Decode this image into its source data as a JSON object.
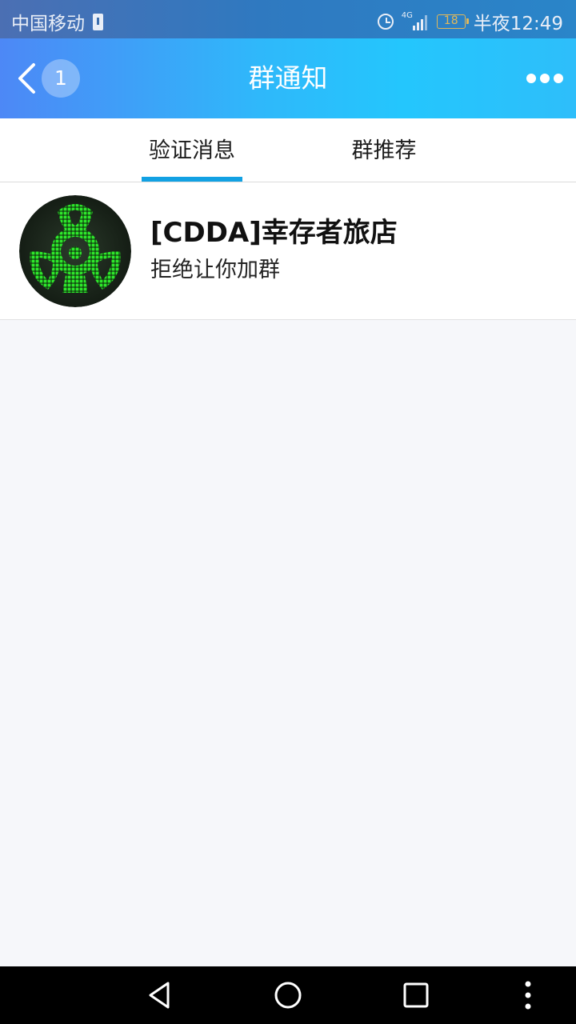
{
  "status_bar": {
    "carrier": "中国移动",
    "network_label": "4G",
    "battery_level": "18",
    "time": "半夜12:49"
  },
  "header": {
    "unread_count": "1",
    "title": "群通知"
  },
  "tabs": [
    {
      "label": "验证消息",
      "active": true
    },
    {
      "label": "群推荐",
      "active": false
    }
  ],
  "notices": [
    {
      "group_name": "[CDDA]幸存者旅店",
      "message": "拒绝让你加群",
      "avatar": "biohazard-icon"
    }
  ],
  "colors": {
    "header_gradient_start": "#4d88f6",
    "header_gradient_end": "#24c6fd",
    "tab_accent": "#12a1e3",
    "page_background": "#f6f7fa",
    "avatar_green": "#2ee82b"
  },
  "nav_icons": [
    "back-triangle-icon",
    "home-circle-icon",
    "recents-square-icon",
    "overflow-menu-icon"
  ]
}
